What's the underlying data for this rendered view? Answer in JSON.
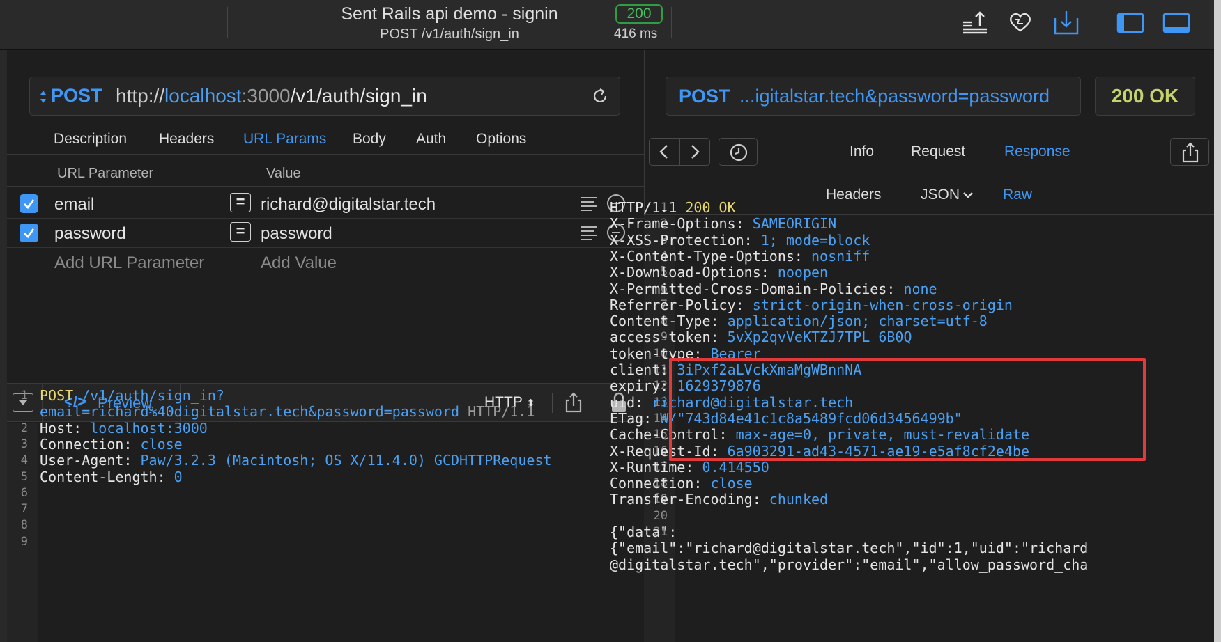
{
  "titlebar": {
    "title": "Sent Rails api demo -  signin",
    "subtitle": "POST /v1/auth/sign_in",
    "status_code": "200",
    "duration": "416 ms",
    "icons": [
      "export-icon",
      "heart-icon",
      "import-icon",
      "sidebar-left-icon",
      "panel-bottom-icon"
    ]
  },
  "request": {
    "method": "POST",
    "url_scheme": "http://",
    "url_host": "localhost",
    "url_colon_port": ":3000",
    "url_path": "/v1/auth/sign_in",
    "tabs": [
      "Description",
      "Headers",
      "URL Params",
      "Body",
      "Auth",
      "Options"
    ],
    "active_tab": "URL Params",
    "params_header": {
      "key": "URL Parameter",
      "value": "Value"
    },
    "params": [
      {
        "key": "email",
        "value": "richard@digitalstar.tech",
        "enabled": true
      },
      {
        "key": "password",
        "value": "password",
        "enabled": true
      }
    ],
    "add_param_placeholder": "Add URL Parameter",
    "add_value_placeholder": "Add Value"
  },
  "preview": {
    "label": "Preview",
    "format": "HTTP",
    "lines": [
      {
        "n": "1",
        "parts": [
          [
            "y",
            "POST "
          ],
          [
            "v",
            "/v1/auth/sign_in?"
          ]
        ]
      },
      {
        "n": "",
        "parts": [
          [
            "v",
            "email=richard%40digitalstar.tech&password=password"
          ],
          [
            "g",
            " HTTP/1.1"
          ]
        ]
      },
      {
        "n": "2",
        "parts": [
          [
            "k",
            "Host: "
          ],
          [
            "v",
            "localhost:3000"
          ]
        ]
      },
      {
        "n": "3",
        "parts": [
          [
            "k",
            "Connection: "
          ],
          [
            "v",
            "close"
          ]
        ]
      },
      {
        "n": "4",
        "parts": [
          [
            "k",
            "User-Agent: "
          ],
          [
            "v",
            "Paw/3.2.3 (Macintosh; OS X/11.4.0) GCDHTTPRequest"
          ]
        ]
      },
      {
        "n": "5",
        "parts": [
          [
            "k",
            "Content-Length: "
          ],
          [
            "v",
            "0"
          ]
        ]
      },
      {
        "n": "6",
        "parts": []
      },
      {
        "n": "7",
        "parts": []
      },
      {
        "n": "8",
        "parts": []
      },
      {
        "n": "9",
        "parts": []
      }
    ]
  },
  "response": {
    "method": "POST",
    "url_tail": "...igitalstar.tech&password=password",
    "status": "200 OK",
    "tabs": [
      "Info",
      "Request",
      "Response"
    ],
    "active_tab": "Response",
    "subtabs": [
      "Headers",
      "JSON",
      "Raw"
    ],
    "active_subtab": "Raw",
    "lines": [
      {
        "n": "1",
        "parts": [
          [
            "k",
            "HTTP/1.1 "
          ],
          [
            "y",
            "200 OK"
          ]
        ]
      },
      {
        "n": "2",
        "parts": [
          [
            "k",
            "X-Frame-Options: "
          ],
          [
            "v",
            "SAMEORIGIN"
          ]
        ]
      },
      {
        "n": "3",
        "parts": [
          [
            "k",
            "X-XSS-Protection: "
          ],
          [
            "v",
            "1; mode=block"
          ]
        ]
      },
      {
        "n": "4",
        "parts": [
          [
            "k",
            "X-Content-Type-Options: "
          ],
          [
            "v",
            "nosniff"
          ]
        ]
      },
      {
        "n": "5",
        "parts": [
          [
            "k",
            "X-Download-Options: "
          ],
          [
            "v",
            "noopen"
          ]
        ]
      },
      {
        "n": "6",
        "parts": [
          [
            "k",
            "X-Permitted-Cross-Domain-Policies: "
          ],
          [
            "v",
            "none"
          ]
        ]
      },
      {
        "n": "7",
        "parts": [
          [
            "k",
            "Referrer-Policy: "
          ],
          [
            "v",
            "strict-origin-when-cross-origin"
          ]
        ]
      },
      {
        "n": "8",
        "parts": [
          [
            "k",
            "Content-Type: "
          ],
          [
            "v",
            "application/json; charset=utf-8"
          ]
        ]
      },
      {
        "n": "9",
        "parts": [
          [
            "k",
            "access-token: "
          ],
          [
            "v",
            "5vXp2qvVeKTZJ7TPL_6B0Q"
          ]
        ]
      },
      {
        "n": "10",
        "parts": [
          [
            "k",
            "token-type: "
          ],
          [
            "v",
            "Bearer"
          ]
        ]
      },
      {
        "n": "11",
        "parts": [
          [
            "k",
            "client: "
          ],
          [
            "v",
            "3iPxf2aLVckXmaMgWBnnNA"
          ]
        ]
      },
      {
        "n": "12",
        "parts": [
          [
            "k",
            "expiry: "
          ],
          [
            "v",
            "1629379876"
          ]
        ]
      },
      {
        "n": "13",
        "parts": [
          [
            "k",
            "uid: "
          ],
          [
            "v",
            "richard@digitalstar.tech"
          ]
        ]
      },
      {
        "n": "14",
        "parts": [
          [
            "k",
            "ETag: "
          ],
          [
            "v",
            "W/\"743d84e41c1c8a5489fcd06d3456499b\""
          ]
        ]
      },
      {
        "n": "15",
        "parts": [
          [
            "k",
            "Cache-Control: "
          ],
          [
            "v",
            "max-age=0, private, must-revalidate"
          ]
        ]
      },
      {
        "n": "16",
        "parts": [
          [
            "k",
            "X-Request-Id: "
          ],
          [
            "v",
            "6a903291-ad43-4571-ae19-e5af8cf2e4be"
          ]
        ]
      },
      {
        "n": "17",
        "parts": [
          [
            "k",
            "X-Runtime: "
          ],
          [
            "v",
            "0.414550"
          ]
        ]
      },
      {
        "n": "18",
        "parts": [
          [
            "k",
            "Connection: "
          ],
          [
            "v",
            "close"
          ]
        ]
      },
      {
        "n": "19",
        "parts": [
          [
            "k",
            "Transfer-Encoding: "
          ],
          [
            "v",
            "chunked"
          ]
        ]
      },
      {
        "n": "20",
        "parts": []
      },
      {
        "n": "21",
        "parts": [
          [
            "k",
            "{\"data\":"
          ]
        ]
      },
      {
        "n": "",
        "parts": [
          [
            "k",
            "{\"email\":\"richard@digitalstar.tech\",\"id\":1,\"uid\":\"richard"
          ]
        ]
      },
      {
        "n": "",
        "parts": [
          [
            "k",
            "@digitalstar.tech\",\"provider\":\"email\",\"allow_password_cha"
          ]
        ]
      }
    ]
  },
  "colors": {
    "accent": "#3f97f5",
    "status_green": "#44c25a",
    "highlight": "#e03a3a"
  }
}
